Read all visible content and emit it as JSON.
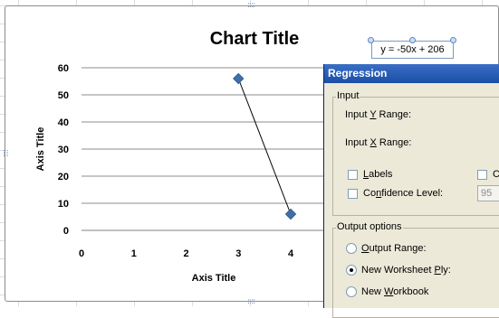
{
  "chart": {
    "title": "Chart Title",
    "x_axis_title": "Axis Title",
    "y_axis_title": "Axis Title",
    "trendline_equation": "y = -50x + 206"
  },
  "chart_data": {
    "type": "scatter",
    "title": "Chart Title",
    "xlabel": "Axis Title",
    "ylabel": "Axis Title",
    "xlim": [
      0,
      4
    ],
    "ylim": [
      0,
      60
    ],
    "x_ticks": [
      "0",
      "1",
      "2",
      "3",
      "4"
    ],
    "y_ticks": [
      "0",
      "10",
      "20",
      "30",
      "40",
      "50",
      "60"
    ],
    "grid": "horizontal",
    "series": [
      {
        "x": [
          3,
          4
        ],
        "y": [
          56,
          6
        ],
        "color": "#3f6fa8"
      }
    ],
    "trendline": "y = -50x + 206"
  },
  "dialog": {
    "title": "Regression",
    "input_group": "Input",
    "input_y_pre": "Input ",
    "input_y_key": "Y",
    "input_y_post": " Range:",
    "input_x_pre": "Input ",
    "input_x_key": "X",
    "input_x_post": " Range:",
    "labels_key": "L",
    "labels_rest": "abels",
    "partial_checkbox_label": "C",
    "conf_pre": "Co",
    "conf_key": "n",
    "conf_post": "fidence Level:",
    "confidence_value": "95",
    "output_group": "Output options",
    "out_range_key": "O",
    "out_range_rest": "utput Range:",
    "new_ws_pre": "New Worksheet ",
    "new_ws_key": "P",
    "new_ws_post": "ly:",
    "new_wb_pre": "New ",
    "new_wb_key": "W",
    "new_wb_post": "orkbook"
  },
  "colors": {
    "marker": "#3f6fa8",
    "titlebar": "#1b4ea6",
    "dialog_bg": "#ece9d8"
  }
}
